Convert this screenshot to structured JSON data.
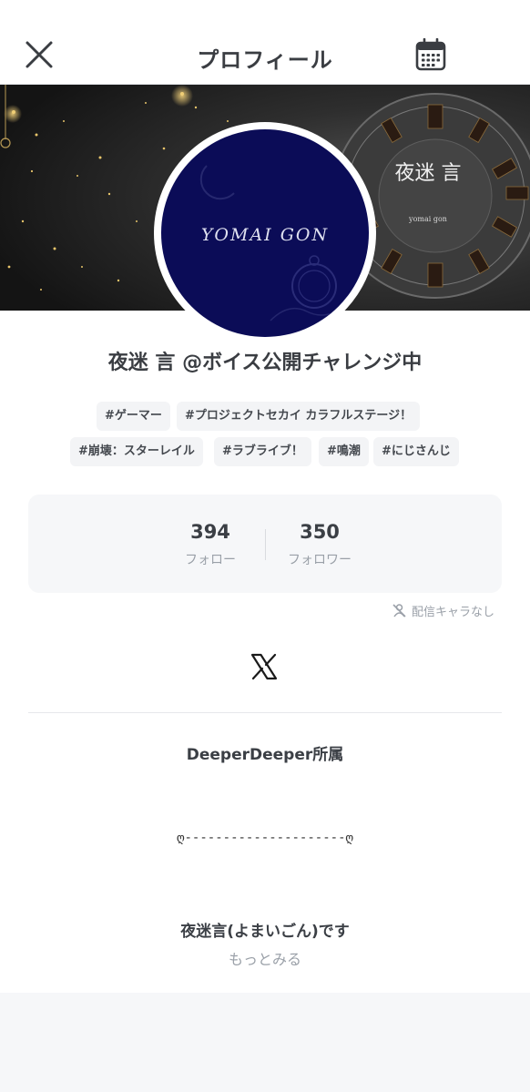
{
  "header": {
    "title": "プロフィール"
  },
  "banner": {
    "clock_label": "夜迷 言",
    "clock_sub": "yomai gon"
  },
  "avatar": {
    "text": "YOMAI GON"
  },
  "profile": {
    "display_name": "夜迷 言 @ボイス公開チャレンジ中",
    "tags": [
      "#ゲーマー",
      "#プロジェクトセカイ カラフルステージ！",
      "#崩壊：スターレイル",
      "#ラブライブ！",
      "#鳴潮",
      "#にじさんじ"
    ]
  },
  "stats": {
    "following_count": "394",
    "following_label": "フォロー",
    "followers_count": "350",
    "followers_label": "フォロワー"
  },
  "streaming": {
    "status_text": "配信キャラなし"
  },
  "bio": {
    "affiliation": "DeeperDeeper所属",
    "divider": "ღ---------------------ღ",
    "intro": "夜迷言(よまいごん)です",
    "more_label": "もっとみる"
  },
  "colors": {
    "accent_text": "#3b3f45",
    "muted_text": "#9aa0a8",
    "avatar_bg": "#0b0c57",
    "tag_bg": "#f3f4f6",
    "page_bg": "#f6f7f9"
  },
  "icons": {
    "close": "close-icon",
    "calendar": "calendar-icon",
    "no_stream": "no-stream-icon",
    "x_logo": "x-logo-icon"
  }
}
